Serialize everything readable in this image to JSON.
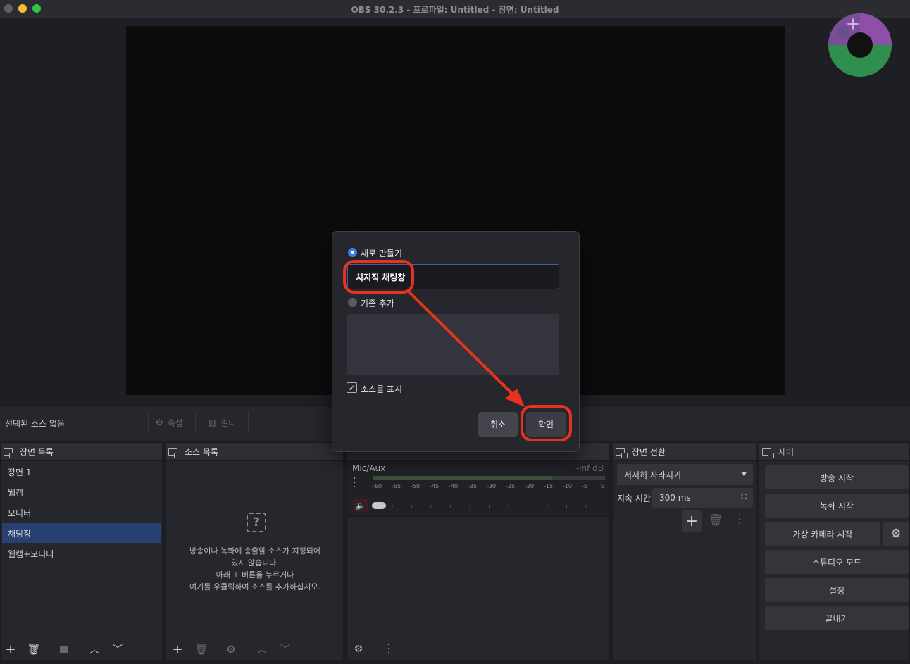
{
  "window": {
    "title": "OBS 30.2.3 - 프로파일: Untitled - 장면: Untitled"
  },
  "source_toolbar": {
    "no_source_label": "선택된 소스 없음",
    "properties_label": "속성",
    "filters_label": "필터"
  },
  "scenes_dock": {
    "title": "장면 목록",
    "items": [
      "장면 1",
      "웹캠",
      "모니터",
      "채팅창",
      "웹캠+모니터"
    ],
    "selected_index": 3
  },
  "sources_dock": {
    "title": "소스 목록",
    "empty_line1": "방송이나 녹화에 송출할 소스가 지정되어",
    "empty_line2": "있지 않습니다.",
    "empty_line3": "아래 + 버튼을 누르거나",
    "empty_line4": "여기를 우클릭하여 소스를 추가하십시오."
  },
  "mixer_dock": {
    "channel_name": "Mic/Aux",
    "level": "-inf dB",
    "ticks": [
      "-60",
      "-55",
      "-50",
      "-45",
      "-40",
      "-35",
      "-30",
      "-25",
      "-20",
      "-15",
      "-10",
      "-5",
      "0"
    ]
  },
  "transitions_dock": {
    "title": "장면 전환",
    "transition": "서서히 사라지기",
    "duration_label": "지속 시간",
    "duration_value": "300 ms"
  },
  "controls_dock": {
    "title": "제어",
    "start_streaming": "방송 시작",
    "start_recording": "녹화 시작",
    "start_virtual_camera": "가상 카메라 시작",
    "studio_mode": "스튜디오 모드",
    "settings": "설정",
    "exit": "끝내기"
  },
  "dialog": {
    "create_new_label": "새로 만들기",
    "name_value": "치지직 채팅창",
    "add_existing_label": "기존 추가",
    "make_visible_label": "소스를 표시",
    "cancel_label": "취소",
    "ok_label": "확인"
  },
  "colors": {
    "selection": "#274071",
    "accent": "#3b7ee8",
    "annotation": "#e8321e"
  }
}
